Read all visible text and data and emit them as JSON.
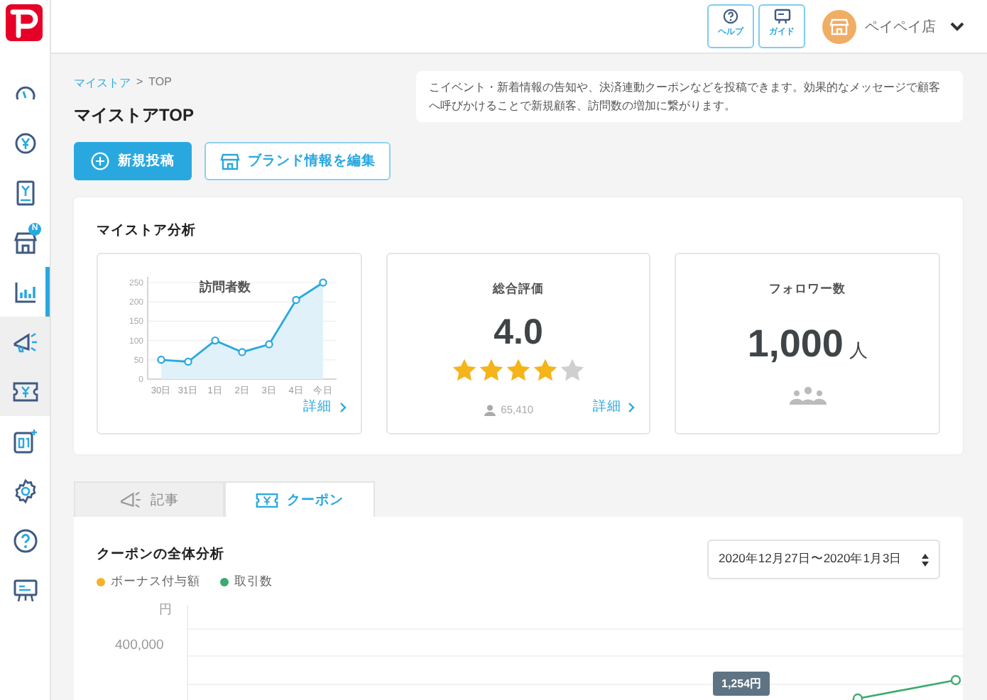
{
  "sidebar": {
    "items": [
      {
        "selected": false,
        "shaded": false
      },
      {
        "selected": false,
        "shaded": false
      },
      {
        "selected": false,
        "shaded": false
      },
      {
        "selected": false,
        "shaded": false,
        "badge": "N"
      },
      {
        "selected": true,
        "shaded": false
      },
      {
        "selected": false,
        "shaded": true
      },
      {
        "selected": false,
        "shaded": true
      },
      {
        "selected": false,
        "shaded": false
      },
      {
        "selected": false,
        "shaded": false
      },
      {
        "selected": false,
        "shaded": false
      },
      {
        "selected": false,
        "shaded": false
      }
    ]
  },
  "header": {
    "buttons": [
      {
        "label": "ヘルプ"
      },
      {
        "label": "ガイド"
      }
    ],
    "store": {
      "name": "ペイペイ店"
    }
  },
  "breadcrumb": {
    "items": [
      "マイストア",
      "TOP"
    ],
    "separator": ">"
  },
  "page_title": "マイストアTOP",
  "actions": [
    {
      "label": "新規投稿",
      "kind": "primary"
    },
    {
      "label": "ブランド情報を編集",
      "kind": "outline"
    }
  ],
  "notice": "こイベント・新着情報の告知や、決済連動クーポンなどを投稿できます。効果的なメッセージで顧客へ呼びかけることで新規顧客、訪問数の増加に繋がります。",
  "analysis": {
    "title": "マイストア分析",
    "visitors": {
      "chart_data": {
        "type": "area",
        "title": "訪問者数",
        "categories": [
          "30日",
          "31日",
          "1日",
          "2日",
          "3日",
          "4日",
          "今日"
        ],
        "values": [
          50,
          45,
          100,
          70,
          90,
          205,
          250
        ],
        "ylim": [
          0,
          250
        ],
        "grid": true,
        "yticks": [
          0,
          50,
          100,
          150,
          200,
          250
        ]
      },
      "link": "詳細"
    },
    "rating": {
      "title": "総合評価",
      "score": "4.0",
      "stars": 4,
      "reviewers": "65,410",
      "link": "詳細"
    },
    "followers": {
      "title": "フォロワー数",
      "count": "1,000",
      "unit": "人"
    }
  },
  "tabs": [
    {
      "label": "記事",
      "selected": false
    },
    {
      "label": "クーポン",
      "selected": true
    }
  ],
  "coupon": {
    "title": "クーポンの全体分析",
    "legend": [
      {
        "label": "ボーナス付与額",
        "color": "#f2b327"
      },
      {
        "label": "取引数",
        "color": "#3daa6e"
      }
    ],
    "date_range": "2020年12月27日〜2020年1月3日",
    "y_unit": "円",
    "y_label": "400,000",
    "tooltip": "1,254円"
  }
}
